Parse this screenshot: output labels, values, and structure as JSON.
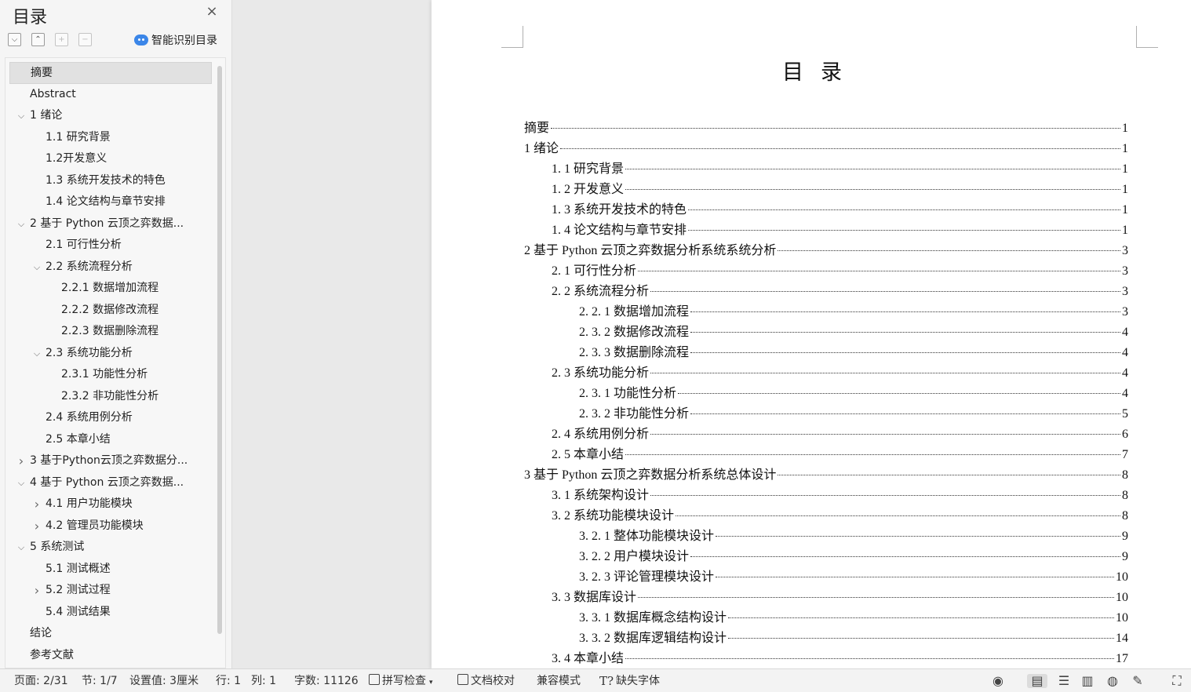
{
  "nav": {
    "title": "目录",
    "smart_toc_label": "智能识别目录",
    "items": [
      {
        "label": "摘要",
        "level": 0,
        "arrow": "",
        "selected": true
      },
      {
        "label": "Abstract",
        "level": 0,
        "arrow": ""
      },
      {
        "label": "1  绪论",
        "level": 0,
        "arrow": "down"
      },
      {
        "label": "1.1 研究背景",
        "level": 1,
        "arrow": ""
      },
      {
        "label": "1.2开发意义",
        "level": 1,
        "arrow": ""
      },
      {
        "label": "1.3 系统开发技术的特色",
        "level": 1,
        "arrow": ""
      },
      {
        "label": "1.4 论文结构与章节安排",
        "level": 1,
        "arrow": ""
      },
      {
        "label": "2  基于 Python 云顶之弈数据...",
        "level": 0,
        "arrow": "down"
      },
      {
        "label": "2.1  可行性分析",
        "level": 1,
        "arrow": ""
      },
      {
        "label": "2.2 系统流程分析",
        "level": 1,
        "arrow": "down"
      },
      {
        "label": "2.2.1  数据增加流程",
        "level": 2,
        "arrow": ""
      },
      {
        "label": "2.2.2  数据修改流程",
        "level": 2,
        "arrow": ""
      },
      {
        "label": "2.2.3  数据删除流程",
        "level": 2,
        "arrow": ""
      },
      {
        "label": "2.3   系统功能分析",
        "level": 1,
        "arrow": "down"
      },
      {
        "label": "2.3.1  功能性分析",
        "level": 2,
        "arrow": ""
      },
      {
        "label": "2.3.2  非功能性分析",
        "level": 2,
        "arrow": ""
      },
      {
        "label": "2.4   系统用例分析",
        "level": 1,
        "arrow": ""
      },
      {
        "label": "2.5 本章小结",
        "level": 1,
        "arrow": ""
      },
      {
        "label": "3  基于Python云顶之弈数据分...",
        "level": 0,
        "arrow": "right"
      },
      {
        "label": "4  基于 Python 云顶之弈数据...",
        "level": 0,
        "arrow": "down"
      },
      {
        "label": "4.1 用户功能模块",
        "level": 1,
        "arrow": "right"
      },
      {
        "label": "4.2 管理员功能模块",
        "level": 1,
        "arrow": "right"
      },
      {
        "label": "5 系统测试",
        "level": 0,
        "arrow": "down"
      },
      {
        "label": "5.1 测试概述",
        "level": 1,
        "arrow": ""
      },
      {
        "label": "5.2 测试过程",
        "level": 1,
        "arrow": "right"
      },
      {
        "label": "5.4 测试结果",
        "level": 1,
        "arrow": ""
      },
      {
        "label": "结论",
        "level": 0,
        "arrow": ""
      },
      {
        "label": "参考文献",
        "level": 0,
        "arrow": ""
      }
    ]
  },
  "document": {
    "heading": "目录",
    "toc": [
      {
        "text": "摘要",
        "page": "1",
        "indent": 0
      },
      {
        "text": "1  绪论",
        "page": "1",
        "indent": 0
      },
      {
        "text": "1. 1 研究背景",
        "page": "1",
        "indent": 1
      },
      {
        "text": "1. 2 开发意义",
        "page": "1",
        "indent": 1
      },
      {
        "text": "1. 3 系统开发技术的特色",
        "page": "1",
        "indent": 1
      },
      {
        "text": "1. 4 论文结构与章节安排",
        "page": "1",
        "indent": 1
      },
      {
        "text": "2  基于 Python 云顶之弈数据分析系统系统分析",
        "page": "3",
        "indent": 0
      },
      {
        "text": "2. 1   可行性分析",
        "page": "3",
        "indent": 1
      },
      {
        "text": "2. 2   系统流程分析",
        "page": "3",
        "indent": 1
      },
      {
        "text": "2. 2. 1 数据增加流程",
        "page": "3",
        "indent": 2
      },
      {
        "text": "2. 3. 2 数据修改流程",
        "page": "4",
        "indent": 2
      },
      {
        "text": "2. 3. 3 数据删除流程",
        "page": "4",
        "indent": 2
      },
      {
        "text": "2. 3   系统功能分析",
        "page": "4",
        "indent": 1
      },
      {
        "text": "2. 3. 1   功能性分析",
        "page": "4",
        "indent": 2
      },
      {
        "text": "2. 3. 2   非功能性分析",
        "page": "5",
        "indent": 2
      },
      {
        "text": "2. 4   系统用例分析",
        "page": "6",
        "indent": 1
      },
      {
        "text": "2. 5 本章小结",
        "page": "7",
        "indent": 1
      },
      {
        "text": "3  基于 Python 云顶之弈数据分析系统总体设计",
        "page": "8",
        "indent": 0
      },
      {
        "text": "3. 1   系统架构设计",
        "page": "8",
        "indent": 1
      },
      {
        "text": "3. 2   系统功能模块设计",
        "page": "8",
        "indent": 1
      },
      {
        "text": "3. 2. 1 整体功能模块设计",
        "page": "9",
        "indent": 2
      },
      {
        "text": "3. 2. 2 用户模块设计",
        "page": "9",
        "indent": 2
      },
      {
        "text": "3. 2. 3 评论管理模块设计",
        "page": "10",
        "indent": 2
      },
      {
        "text": "3. 3   数据库设计",
        "page": "10",
        "indent": 1
      },
      {
        "text": "3. 3. 1   数据库概念结构设计",
        "page": "10",
        "indent": 2
      },
      {
        "text": "3. 3. 2   数据库逻辑结构设计",
        "page": "14",
        "indent": 2
      },
      {
        "text": "3. 4 本章小结",
        "page": "17",
        "indent": 1
      }
    ]
  },
  "status_bar": {
    "page": "页面: 2/31",
    "section": "节: 1/7",
    "setting": "设置值: 3厘米",
    "row": "行: 1",
    "col": "列: 1",
    "words": "字数: 11126",
    "spell_check": "拼写检查",
    "proofread": "文档校对",
    "compat": "兼容模式",
    "missing_font": "缺失字体"
  }
}
